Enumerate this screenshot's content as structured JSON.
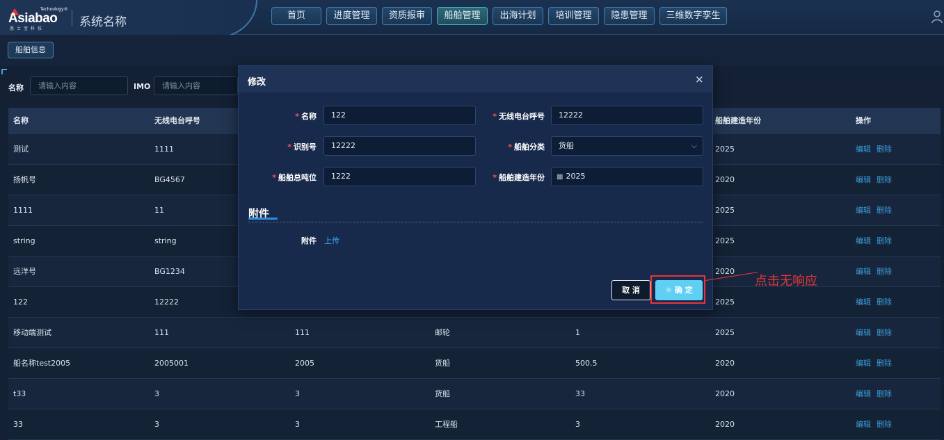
{
  "header": {
    "logo_text": "Asiabao",
    "logo_tech": "Technology®",
    "logo_sub": "恩士宝科技",
    "system_name": "系统名称",
    "nav": [
      "首页",
      "进度管理",
      "资质报审",
      "船舶管理",
      "出海计划",
      "培训管理",
      "隐患管理",
      "三维数字孪生"
    ],
    "active_nav": "船舶管理"
  },
  "breadcrumb": {
    "tag": "船舶信息"
  },
  "filters": {
    "name_label": "名称",
    "name_placeholder": "请输入内容",
    "imo_label": "IMO",
    "imo_placeholder": "请输入内容"
  },
  "table": {
    "columns": [
      "名称",
      "无线电台呼号",
      "",
      "",
      "",
      "船舶建造年份",
      "操作"
    ],
    "rows": [
      [
        "测试",
        "1111",
        "",
        "",
        "",
        "2025"
      ],
      [
        "扬帆号",
        "BG4567",
        "",
        "",
        "",
        "2020"
      ],
      [
        "1111",
        "11",
        "",
        "",
        "",
        "2025"
      ],
      [
        "string",
        "string",
        "",
        "",
        "",
        "2025"
      ],
      [
        "远洋号",
        "BG1234",
        "",
        "",
        "",
        "2020"
      ],
      [
        "122",
        "12222",
        "",
        "",
        "",
        "2025"
      ],
      [
        "移动端测试",
        "111",
        "111",
        "邮轮",
        "1",
        "2025"
      ],
      [
        "船名称test2005",
        "2005001",
        "2005",
        "货船",
        "500.5",
        "2020"
      ],
      [
        "t33",
        "3",
        "3",
        "货船",
        "33",
        "2020"
      ],
      [
        "33",
        "3",
        "3",
        "工程船",
        "3",
        "2020"
      ]
    ],
    "edit_label": "编辑",
    "delete_label": "删除"
  },
  "dialog": {
    "title": "修改",
    "close": "×",
    "fields": {
      "name_label": "名称",
      "name_value": "122",
      "callsign_label": "无线电台呼号",
      "callsign_value": "12222",
      "id_label": "识别号",
      "id_value": "12222",
      "category_label": "船舶分类",
      "category_value": "货船",
      "tonnage_label": "船舶总吨位",
      "tonnage_value": "1222",
      "year_label": "船舶建造年份",
      "year_value": "2025"
    },
    "section_title": "附件",
    "attach_label": "附件",
    "upload_label": "上传",
    "cancel_label": "取 消",
    "ok_label": "确 定"
  },
  "annotation": {
    "text": "点击无响应",
    "color": "#e8343a"
  }
}
